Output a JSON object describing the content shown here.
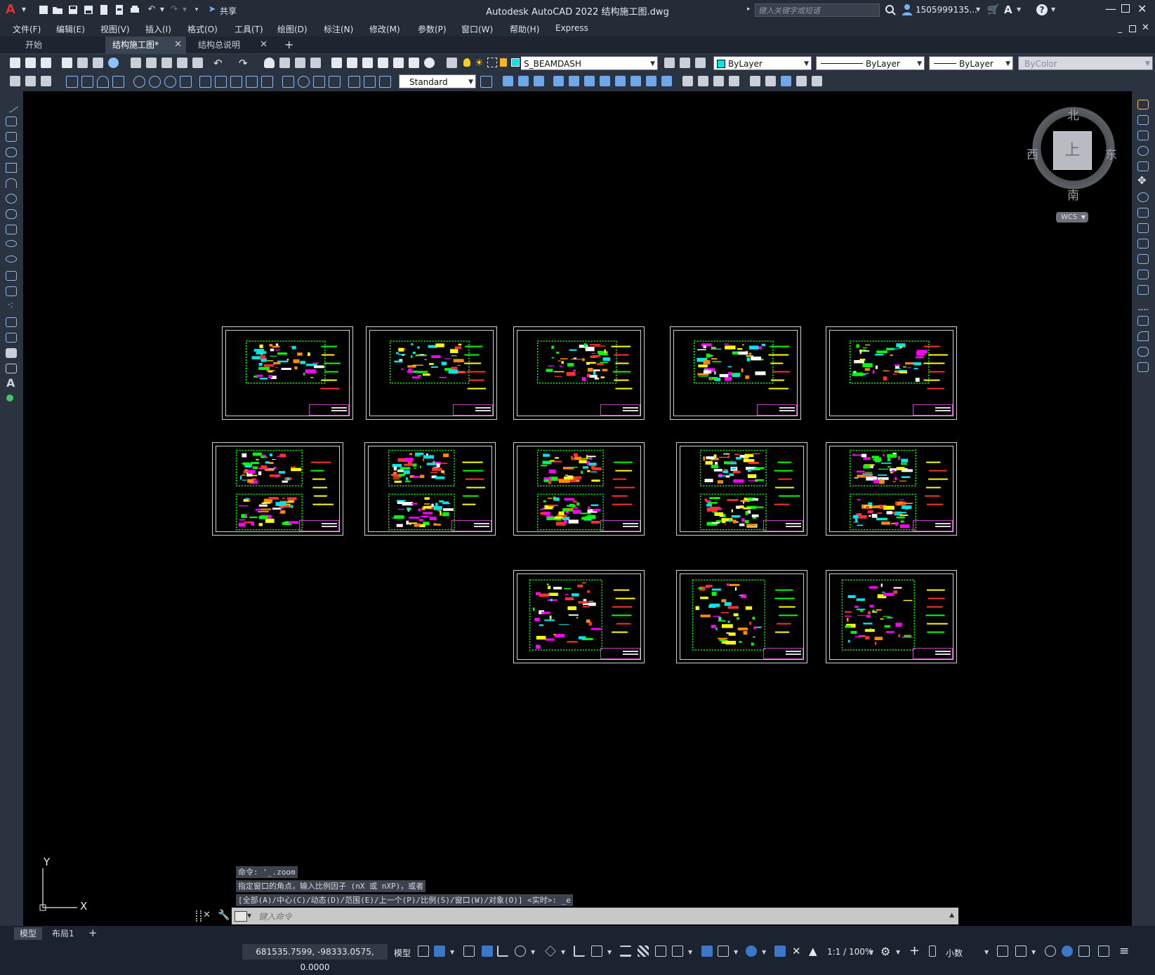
{
  "window": {
    "title": "Autodesk AutoCAD 2022    结构施工图.dwg",
    "share_label": "共享",
    "search_placeholder": "键入关键字或短语",
    "user": "1505999135...",
    "help": "?"
  },
  "menu": [
    "文件(F)",
    "编辑(E)",
    "视图(V)",
    "插入(I)",
    "格式(O)",
    "工具(T)",
    "绘图(D)",
    "标注(N)",
    "修改(M)",
    "参数(P)",
    "窗口(W)",
    "帮助(H)",
    "Express"
  ],
  "tabs": [
    {
      "label": "开始",
      "active": false,
      "closable": false
    },
    {
      "label": "结构施工图*",
      "active": true,
      "closable": true
    },
    {
      "label": "结构总说明",
      "active": false,
      "closable": true
    }
  ],
  "toolbar": {
    "layer": "S_BEAMDASH",
    "layer_color": "#00e5e5",
    "color_value": "ByLayer",
    "linetype": "ByLayer",
    "lineweight": "ByLayer",
    "plotstyle": "ByColor",
    "textstyle": "Standard"
  },
  "viewcube": {
    "north": "北",
    "south": "南",
    "east": "东",
    "west": "西",
    "face": "上",
    "wcs": "WCS"
  },
  "ucs": {
    "x": "X",
    "y": "Y"
  },
  "command": {
    "history": [
      "命令: '_.zoom",
      "指定窗口的角点，输入比例因子 (nX 或 nXP)，或者",
      "[全部(A)/中心(C)/动态(D)/范围(E)/上一个(P)/比例(S)/窗口(W)/对象(O)] <实时>: _e"
    ],
    "placeholder": "键入命令"
  },
  "layouts": [
    "模型",
    "布局1"
  ],
  "status": {
    "coords": "681535.7599, -98333.0575, 0.0000",
    "model": "模型",
    "scale": "1:1 / 100%",
    "units": "小数"
  }
}
